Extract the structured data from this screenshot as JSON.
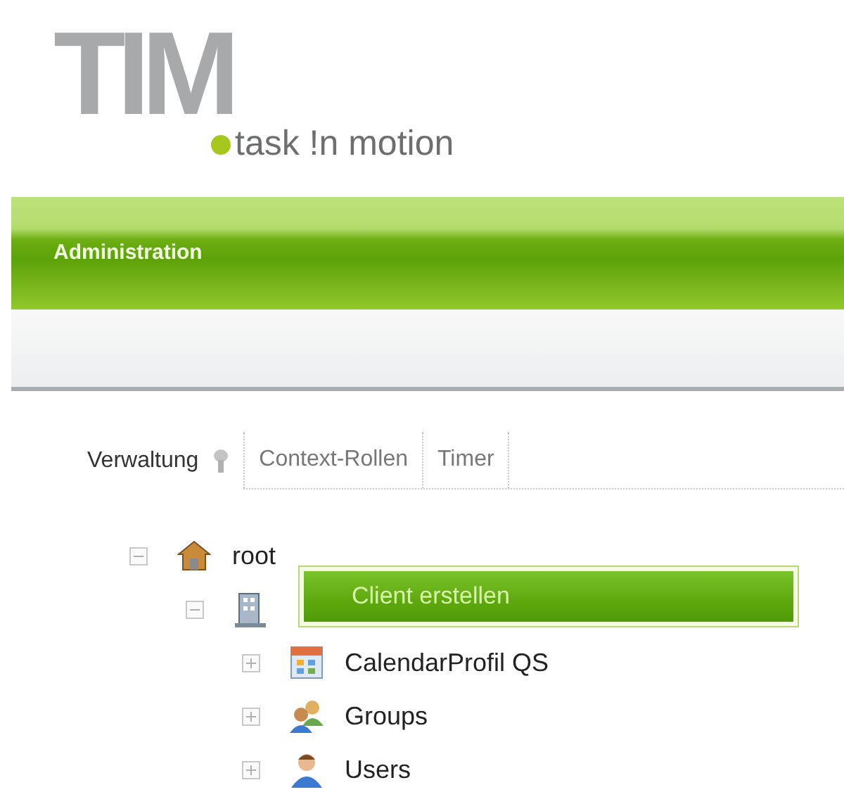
{
  "logo": {
    "letters": "TIM",
    "tagline": "task !n motion"
  },
  "header": {
    "title": "Administration"
  },
  "tabs": [
    {
      "label": "Verwaltung",
      "selected": true,
      "has_icon": true
    },
    {
      "label": "Context-Rollen",
      "selected": false,
      "has_icon": false
    },
    {
      "label": "Timer",
      "selected": false,
      "has_icon": false
    }
  ],
  "tree": [
    {
      "label": "root",
      "kind": "home",
      "expanded": true,
      "children": [
        {
          "kind": "building",
          "expanded": true,
          "children": [
            {
              "label": "CalendarProfil QS",
              "kind": "calendar",
              "expanded": false
            },
            {
              "label": "Groups",
              "kind": "group",
              "expanded": false
            },
            {
              "label": "Users",
              "kind": "user",
              "expanded": false
            }
          ]
        }
      ]
    }
  ],
  "context_menu": {
    "items": [
      {
        "label": "Client erstellen",
        "selected": true
      }
    ]
  }
}
